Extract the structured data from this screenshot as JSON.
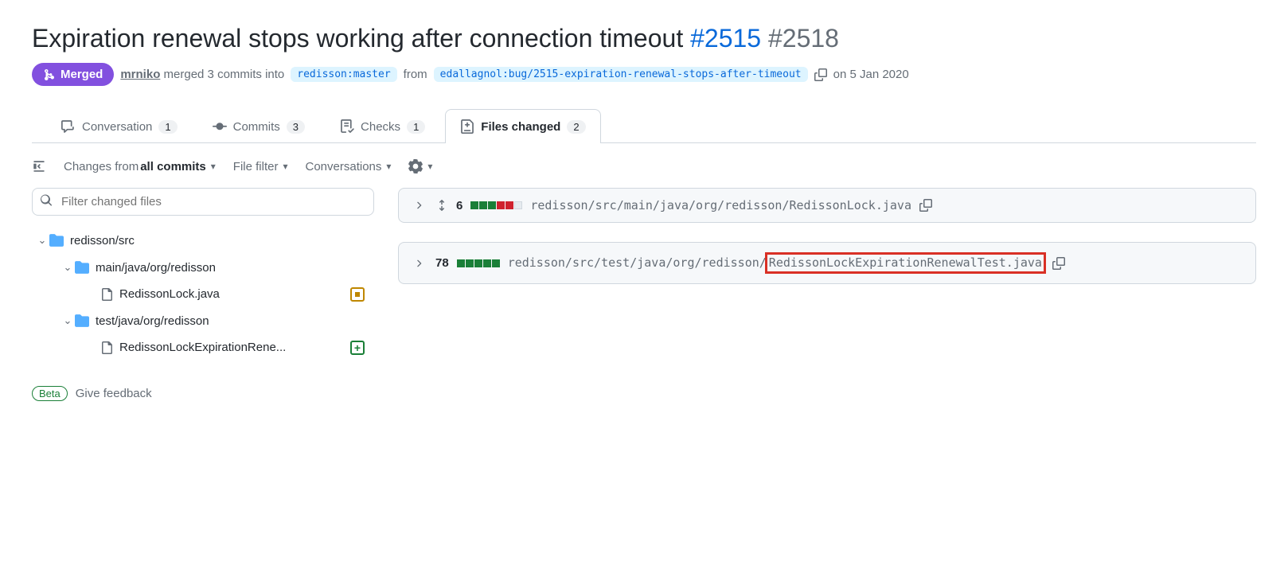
{
  "title": {
    "text": "Expiration renewal stops working after connection timeout",
    "linked_issue": "#2515",
    "pr_number": "#2518"
  },
  "meta": {
    "merged_label": "Merged",
    "user": "mrniko",
    "action_text": "merged 3 commits into",
    "base_branch": "redisson:master",
    "from_text": "from",
    "head_branch": "edallagnol:bug/2515-expiration-renewal-stops-after-timeout",
    "date": "on 5 Jan 2020"
  },
  "tabs": {
    "conversation": {
      "label": "Conversation",
      "count": "1"
    },
    "commits": {
      "label": "Commits",
      "count": "3"
    },
    "checks": {
      "label": "Checks",
      "count": "1"
    },
    "files": {
      "label": "Files changed",
      "count": "2"
    }
  },
  "toolbar": {
    "changes_prefix": "Changes from ",
    "changes_value": "all commits",
    "file_filter": "File filter",
    "conversations": "Conversations"
  },
  "filter_placeholder": "Filter changed files",
  "tree": {
    "root": "redisson/src",
    "folder_main": "main/java/org/redisson",
    "file_main": "RedissonLock.java",
    "folder_test": "test/java/org/redisson",
    "file_test": "RedissonLockExpirationRene..."
  },
  "feedback": {
    "beta": "Beta",
    "text": "Give feedback"
  },
  "files": [
    {
      "lines": "6",
      "squares": [
        "g",
        "g",
        "g",
        "r",
        "r",
        "n"
      ],
      "path_prefix": "redisson/src/main/java/org/redisson/",
      "path_file": "RedissonLock.java",
      "show_expand": true,
      "highlighted": false
    },
    {
      "lines": "78",
      "squares": [
        "g",
        "g",
        "g",
        "g",
        "g"
      ],
      "path_prefix": "redisson/src/test/java/org/redisson/",
      "path_file": "RedissonLockExpirationRenewalTest.java",
      "show_expand": false,
      "highlighted": true
    }
  ]
}
